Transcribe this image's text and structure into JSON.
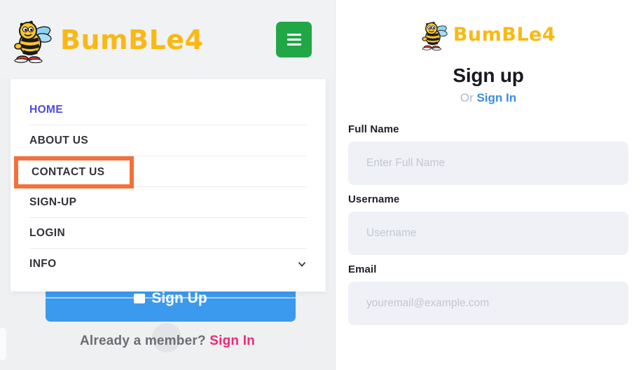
{
  "brand": {
    "name_part1": "B",
    "name": "BumBLe4",
    "logo_icon": "bee-mascot-icon",
    "text_color": "#fbb813"
  },
  "left_panel": {
    "background": "#eff0f2",
    "menu_button": {
      "icon": "hamburger-menu-icon",
      "color": "#22a747",
      "label": ""
    },
    "dropdown": {
      "items": [
        {
          "label": "HOME",
          "active": true
        },
        {
          "label": "ABOUT US",
          "active": false
        },
        {
          "label": "CONTACT US",
          "active": false,
          "highlighted": true
        },
        {
          "label": "SIGN-UP",
          "active": false
        },
        {
          "label": "LOGIN",
          "active": false
        },
        {
          "label": "INFO",
          "active": false,
          "expandable": true
        }
      ],
      "active_color": "#4b4be8",
      "highlight_color": "#f4703a"
    },
    "signup_button": {
      "label": "Sign Up",
      "icon": "user-plus-icon",
      "color": "#3b9aed"
    },
    "footer": {
      "prompt": "Already a member?",
      "link": "Sign In",
      "link_color": "#ec2a75"
    }
  },
  "right_panel": {
    "title": "Sign up",
    "or_text": "Or",
    "signin_link": "Sign In",
    "signin_link_color": "#3b8ce8",
    "fields": [
      {
        "label": "Full Name",
        "placeholder": "Enter Full Name",
        "value": ""
      },
      {
        "label": "Username",
        "placeholder": "Username",
        "value": ""
      },
      {
        "label": "Email",
        "placeholder": "youremail@example.com",
        "value": ""
      }
    ]
  }
}
